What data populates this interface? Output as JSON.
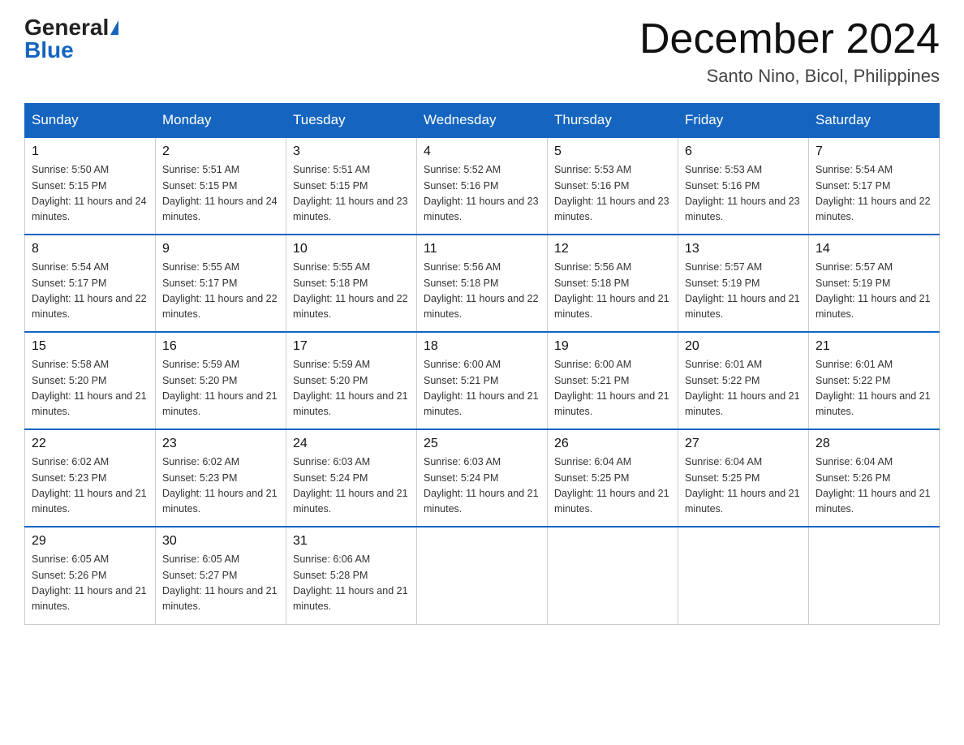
{
  "header": {
    "logo_general": "General",
    "logo_blue": "Blue",
    "month_title": "December 2024",
    "location": "Santo Nino, Bicol, Philippines"
  },
  "weekdays": [
    "Sunday",
    "Monday",
    "Tuesday",
    "Wednesday",
    "Thursday",
    "Friday",
    "Saturday"
  ],
  "weeks": [
    [
      {
        "day": 1,
        "sunrise": "5:50 AM",
        "sunset": "5:15 PM",
        "daylight": "11 hours and 24 minutes."
      },
      {
        "day": 2,
        "sunrise": "5:51 AM",
        "sunset": "5:15 PM",
        "daylight": "11 hours and 24 minutes."
      },
      {
        "day": 3,
        "sunrise": "5:51 AM",
        "sunset": "5:15 PM",
        "daylight": "11 hours and 23 minutes."
      },
      {
        "day": 4,
        "sunrise": "5:52 AM",
        "sunset": "5:16 PM",
        "daylight": "11 hours and 23 minutes."
      },
      {
        "day": 5,
        "sunrise": "5:53 AM",
        "sunset": "5:16 PM",
        "daylight": "11 hours and 23 minutes."
      },
      {
        "day": 6,
        "sunrise": "5:53 AM",
        "sunset": "5:16 PM",
        "daylight": "11 hours and 23 minutes."
      },
      {
        "day": 7,
        "sunrise": "5:54 AM",
        "sunset": "5:17 PM",
        "daylight": "11 hours and 22 minutes."
      }
    ],
    [
      {
        "day": 8,
        "sunrise": "5:54 AM",
        "sunset": "5:17 PM",
        "daylight": "11 hours and 22 minutes."
      },
      {
        "day": 9,
        "sunrise": "5:55 AM",
        "sunset": "5:17 PM",
        "daylight": "11 hours and 22 minutes."
      },
      {
        "day": 10,
        "sunrise": "5:55 AM",
        "sunset": "5:18 PM",
        "daylight": "11 hours and 22 minutes."
      },
      {
        "day": 11,
        "sunrise": "5:56 AM",
        "sunset": "5:18 PM",
        "daylight": "11 hours and 22 minutes."
      },
      {
        "day": 12,
        "sunrise": "5:56 AM",
        "sunset": "5:18 PM",
        "daylight": "11 hours and 21 minutes."
      },
      {
        "day": 13,
        "sunrise": "5:57 AM",
        "sunset": "5:19 PM",
        "daylight": "11 hours and 21 minutes."
      },
      {
        "day": 14,
        "sunrise": "5:57 AM",
        "sunset": "5:19 PM",
        "daylight": "11 hours and 21 minutes."
      }
    ],
    [
      {
        "day": 15,
        "sunrise": "5:58 AM",
        "sunset": "5:20 PM",
        "daylight": "11 hours and 21 minutes."
      },
      {
        "day": 16,
        "sunrise": "5:59 AM",
        "sunset": "5:20 PM",
        "daylight": "11 hours and 21 minutes."
      },
      {
        "day": 17,
        "sunrise": "5:59 AM",
        "sunset": "5:20 PM",
        "daylight": "11 hours and 21 minutes."
      },
      {
        "day": 18,
        "sunrise": "6:00 AM",
        "sunset": "5:21 PM",
        "daylight": "11 hours and 21 minutes."
      },
      {
        "day": 19,
        "sunrise": "6:00 AM",
        "sunset": "5:21 PM",
        "daylight": "11 hours and 21 minutes."
      },
      {
        "day": 20,
        "sunrise": "6:01 AM",
        "sunset": "5:22 PM",
        "daylight": "11 hours and 21 minutes."
      },
      {
        "day": 21,
        "sunrise": "6:01 AM",
        "sunset": "5:22 PM",
        "daylight": "11 hours and 21 minutes."
      }
    ],
    [
      {
        "day": 22,
        "sunrise": "6:02 AM",
        "sunset": "5:23 PM",
        "daylight": "11 hours and 21 minutes."
      },
      {
        "day": 23,
        "sunrise": "6:02 AM",
        "sunset": "5:23 PM",
        "daylight": "11 hours and 21 minutes."
      },
      {
        "day": 24,
        "sunrise": "6:03 AM",
        "sunset": "5:24 PM",
        "daylight": "11 hours and 21 minutes."
      },
      {
        "day": 25,
        "sunrise": "6:03 AM",
        "sunset": "5:24 PM",
        "daylight": "11 hours and 21 minutes."
      },
      {
        "day": 26,
        "sunrise": "6:04 AM",
        "sunset": "5:25 PM",
        "daylight": "11 hours and 21 minutes."
      },
      {
        "day": 27,
        "sunrise": "6:04 AM",
        "sunset": "5:25 PM",
        "daylight": "11 hours and 21 minutes."
      },
      {
        "day": 28,
        "sunrise": "6:04 AM",
        "sunset": "5:26 PM",
        "daylight": "11 hours and 21 minutes."
      }
    ],
    [
      {
        "day": 29,
        "sunrise": "6:05 AM",
        "sunset": "5:26 PM",
        "daylight": "11 hours and 21 minutes."
      },
      {
        "day": 30,
        "sunrise": "6:05 AM",
        "sunset": "5:27 PM",
        "daylight": "11 hours and 21 minutes."
      },
      {
        "day": 31,
        "sunrise": "6:06 AM",
        "sunset": "5:28 PM",
        "daylight": "11 hours and 21 minutes."
      },
      null,
      null,
      null,
      null
    ]
  ]
}
